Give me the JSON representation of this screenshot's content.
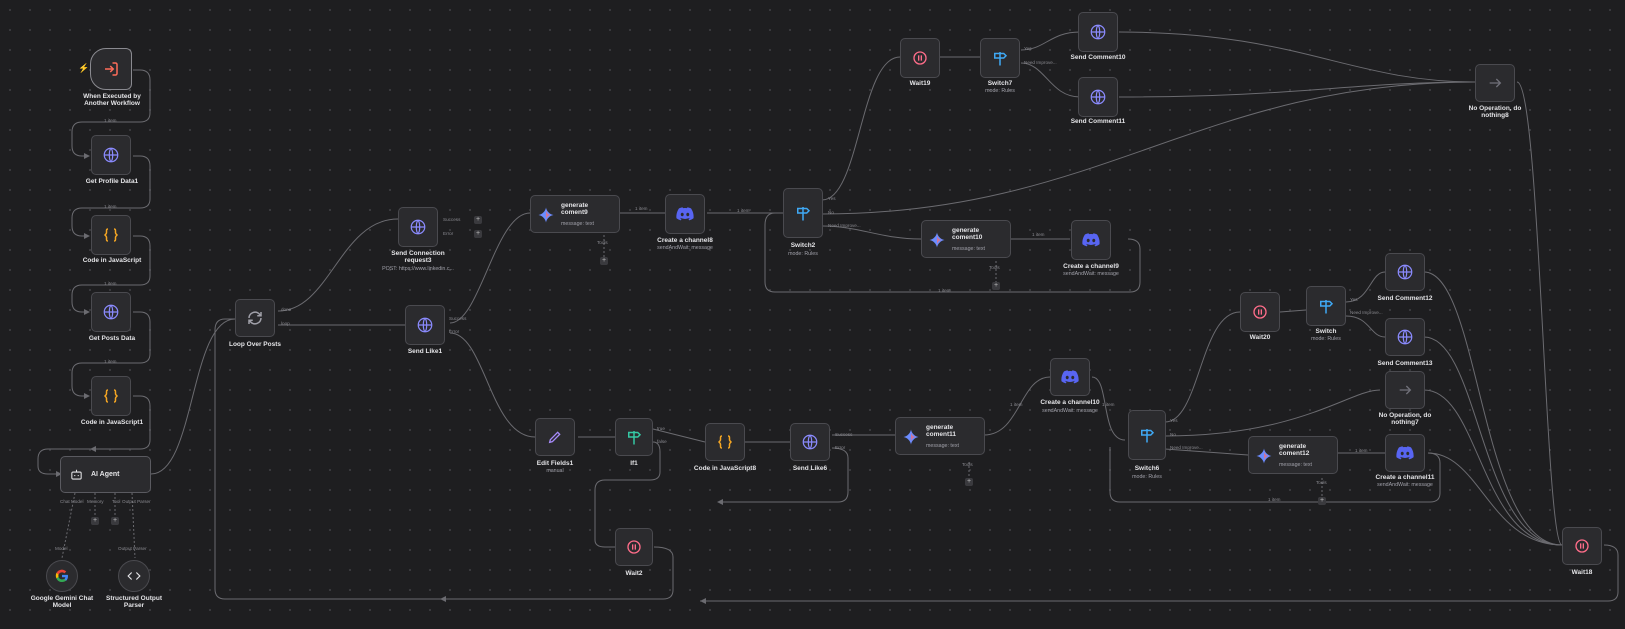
{
  "colors": {
    "background": "#1e1e20",
    "wire": "#6b6b70",
    "node_fill": "#2b2b2e",
    "globe": "#8b8bff",
    "code": "#f5a623",
    "discord": "#5865f2",
    "wait": "#ff6d8a",
    "switch": "#3fa9f5",
    "if": "#35c8a4",
    "edit": "#a78bfa",
    "trigger": "#ff6d5a"
  },
  "nodes": {
    "trigger": {
      "title": "When Executed by Another Workflow",
      "icon": "sign-in-icon"
    },
    "get_profile": {
      "title": "Get Profile Data1",
      "icon": "globe-icon"
    },
    "code_js": {
      "title": "Code in JavaScript",
      "icon": "code-braces-icon"
    },
    "get_posts": {
      "title": "Get Posts Data",
      "icon": "globe-icon"
    },
    "code_js1": {
      "title": "Code in JavaScript1",
      "icon": "code-braces-icon"
    },
    "ai_agent": {
      "title": "AI Agent",
      "icon": "robot-icon",
      "ports": [
        "Chat Model",
        "Memory",
        "Tool",
        "Output Parser"
      ]
    },
    "gemini": {
      "title": "Google Gemini Chat Model",
      "icon": "google-icon",
      "port": "Model"
    },
    "parser": {
      "title": "Structured Output Parser",
      "icon": "code-angle-icon",
      "port": "Output Parser"
    },
    "loop": {
      "title": "Loop Over Posts",
      "icon": "loop-icon",
      "ports": [
        "done",
        "loop"
      ]
    },
    "send_conn": {
      "title": "Send Connection request3",
      "subtitle": "POST: https://www.linkedin.c...",
      "icon": "globe-icon",
      "ports": [
        "Success",
        "Error"
      ]
    },
    "send_like1": {
      "title": "Send Like1",
      "icon": "globe-icon",
      "ports": [
        "Success",
        "Error"
      ]
    },
    "gen9": {
      "title": "generate coment9",
      "subtitle": "message: text",
      "icon": "gemini-icon",
      "port": "Tools"
    },
    "chan8": {
      "title": "Create a channel8",
      "subtitle": "sendAndWait: message",
      "icon": "discord-icon"
    },
    "switch2": {
      "title": "Switch2",
      "subtitle": "mode: Rules",
      "icon": "switch-icon",
      "ports": [
        "Yes",
        "No",
        "Need Improve..."
      ]
    },
    "gen10": {
      "title": "generate coment10",
      "subtitle": "message: text",
      "icon": "gemini-icon",
      "port": "Tools"
    },
    "chan9": {
      "title": "Create a channel9",
      "subtitle": "sendAndWait: message",
      "icon": "discord-icon"
    },
    "wait19": {
      "title": "Wait19",
      "icon": "pause-icon"
    },
    "switch7": {
      "title": "Switch7",
      "subtitle": "mode: Rules",
      "icon": "switch-icon",
      "ports": [
        "Yes",
        "Need Improve..."
      ]
    },
    "comment10": {
      "title": "Send Comment10",
      "icon": "globe-icon"
    },
    "comment11": {
      "title": "Send Comment11",
      "icon": "globe-icon"
    },
    "noop8": {
      "title": "No Operation, do nothing8",
      "icon": "arrow-right-icon"
    },
    "edit1": {
      "title": "Edit Fields1",
      "subtitle": "manual",
      "icon": "pencil-icon"
    },
    "if1": {
      "title": "If1",
      "icon": "if-icon",
      "ports": [
        "true",
        "false"
      ]
    },
    "code_js8": {
      "title": "Code in JavaScript8",
      "icon": "code-braces-icon"
    },
    "send_like6": {
      "title": "Send Like6",
      "icon": "globe-icon",
      "ports": [
        "Success",
        "Error"
      ]
    },
    "gen11": {
      "title": "generate coment11",
      "subtitle": "message: text",
      "icon": "gemini-icon",
      "port": "Tools"
    },
    "chan10": {
      "title": "Create a channel10",
      "subtitle": "sendAndWait: message",
      "icon": "discord-icon"
    },
    "wait2": {
      "title": "Wait2",
      "icon": "pause-icon"
    },
    "switch6": {
      "title": "Switch6",
      "subtitle": "mode: Rules",
      "icon": "switch-icon",
      "ports": [
        "Yes",
        "No",
        "Need Improve..."
      ]
    },
    "wait20": {
      "title": "Wait20",
      "icon": "pause-icon"
    },
    "switch": {
      "title": "Switch",
      "subtitle": "mode: Rules",
      "icon": "switch-icon",
      "ports": [
        "Yes",
        "Need Improve..."
      ]
    },
    "comment12": {
      "title": "Send Comment12",
      "icon": "globe-icon"
    },
    "comment13": {
      "title": "Send Comment13",
      "icon": "globe-icon"
    },
    "noop7": {
      "title": "No Operation, do nothing7",
      "icon": "arrow-right-icon"
    },
    "gen12": {
      "title": "generate coment12",
      "subtitle": "message: text",
      "icon": "gemini-icon",
      "port": "Tools"
    },
    "chan11": {
      "title": "Create a channel11",
      "subtitle": "sendAndWait: message",
      "icon": "discord-icon"
    },
    "wait18": {
      "title": "Wait18",
      "icon": "pause-icon"
    }
  },
  "edge_label": "1 item",
  "plus": "+"
}
